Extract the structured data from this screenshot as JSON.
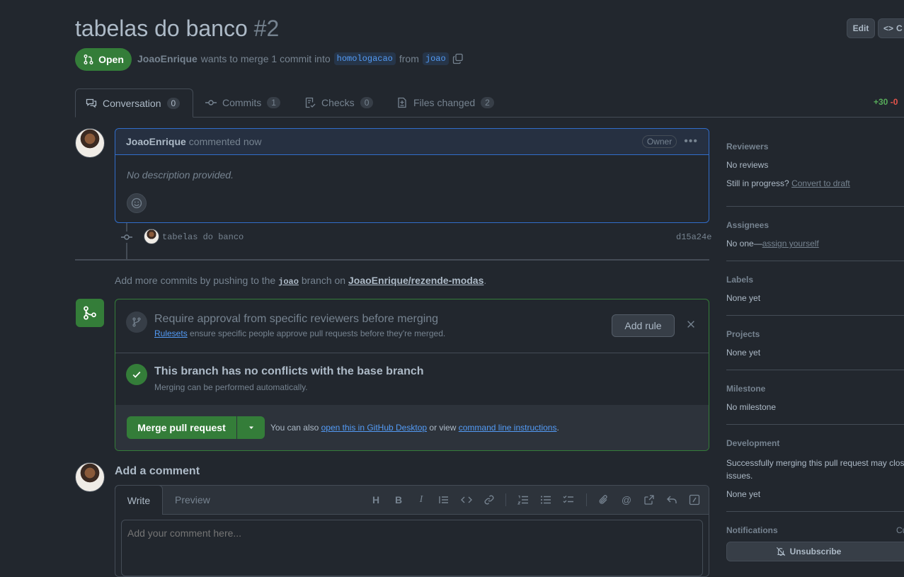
{
  "pr": {
    "title": "tabelas do banco",
    "number": "#2",
    "state": "Open",
    "author": "JoaoEnrique",
    "merge_text": "wants to merge 1 commit into",
    "base_branch": "homologacao",
    "from_text": "from",
    "head_branch": "joao"
  },
  "header_buttons": {
    "edit": "Edit",
    "code": "C"
  },
  "tabs": [
    {
      "label": "Conversation",
      "count": "0"
    },
    {
      "label": "Commits",
      "count": "1"
    },
    {
      "label": "Checks",
      "count": "0"
    },
    {
      "label": "Files changed",
      "count": "2"
    }
  ],
  "diffstat": {
    "added": "+30",
    "removed": "-0"
  },
  "comment": {
    "author": "JoaoEnrique",
    "action": "commented now",
    "badge": "Owner",
    "body": "No description provided."
  },
  "commit": {
    "message": "tabelas do banco",
    "sha": "d15a24e"
  },
  "push_hint": {
    "prefix": "Add more commits by pushing to the",
    "branch": "joao",
    "middle": "branch on",
    "repo": "JoaoEnrique/rezende-modas",
    "suffix": "."
  },
  "rule_prompt": {
    "title": "Require approval from specific reviewers before merging",
    "link": "Rulesets",
    "desc": "ensure specific people approve pull requests before they're merged.",
    "button": "Add rule"
  },
  "conflicts": {
    "title": "This branch has no conflicts with the base branch",
    "desc": "Merging can be performed automatically."
  },
  "merge": {
    "button": "Merge pull request",
    "also_prefix": "You can also",
    "desktop_link": "open this in GitHub Desktop",
    "or_view": "or view",
    "cli_link": "command line instructions",
    "suffix": "."
  },
  "add_comment": {
    "heading": "Add a comment",
    "tab_write": "Write",
    "tab_preview": "Preview",
    "placeholder": "Add your comment here..."
  },
  "sidebar": {
    "reviewers": {
      "label": "Reviewers",
      "value": "No reviews",
      "progress_text": "Still in progress?",
      "draft_link": "Convert to draft"
    },
    "assignees": {
      "label": "Assignees",
      "value": "No one—",
      "assign_link": "assign yourself"
    },
    "labels": {
      "label": "Labels",
      "value": "None yet"
    },
    "projects": {
      "label": "Projects",
      "value": "None yet"
    },
    "milestone": {
      "label": "Milestone",
      "value": "No milestone"
    },
    "development": {
      "label": "Development",
      "desc": "Successfully merging this pull request may close issues.",
      "value": "None yet"
    },
    "notifications": {
      "label": "Notifications",
      "customize": "Cu",
      "button": "Unsubscribe"
    }
  },
  "colors": {
    "bg": "#22272e",
    "accent": "#539bf5",
    "success": "#347d39",
    "border": "#444c56"
  }
}
